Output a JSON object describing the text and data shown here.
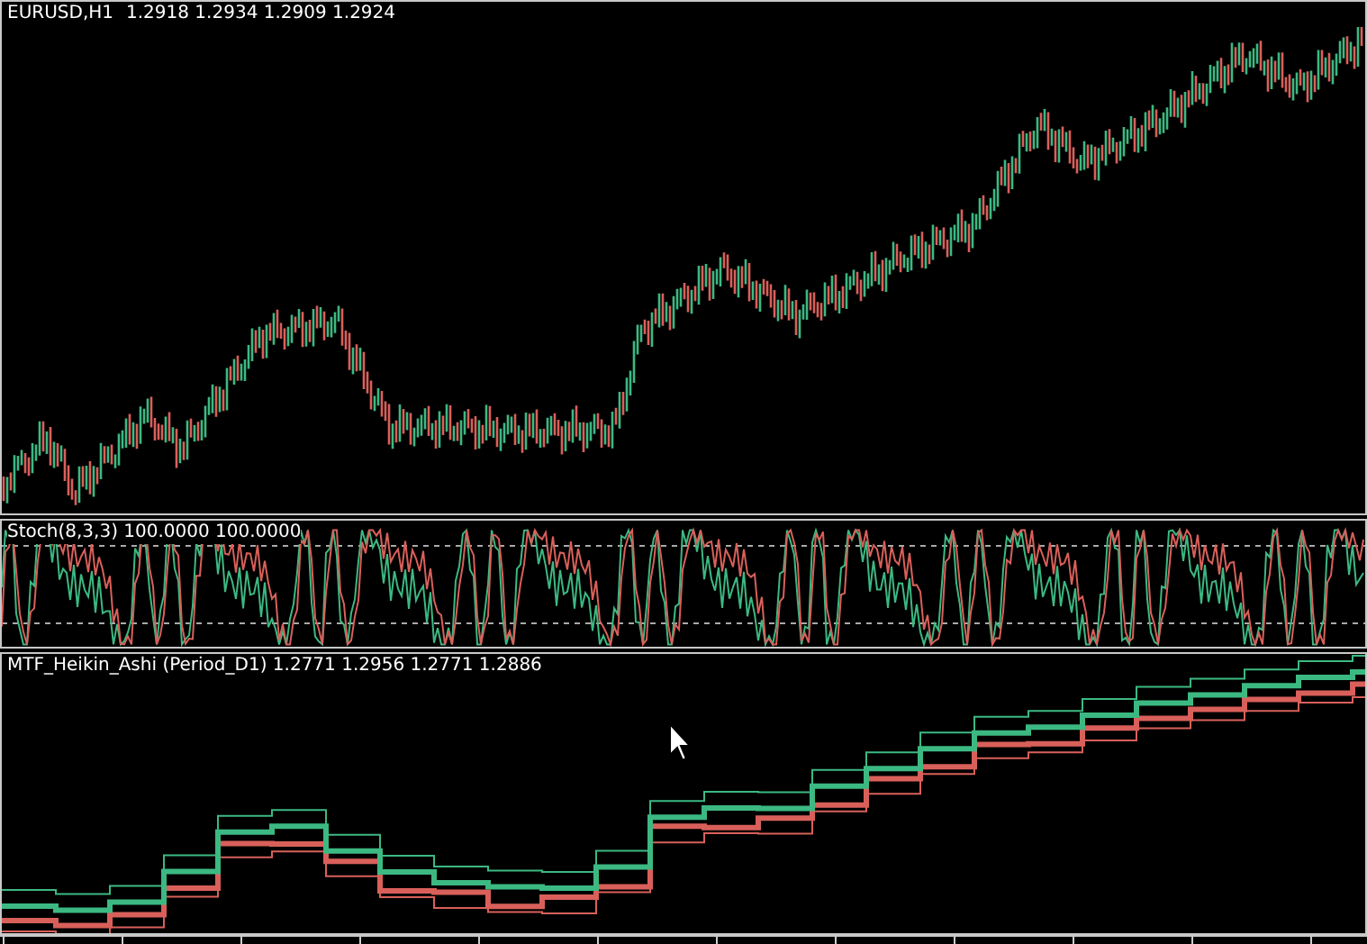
{
  "main_chart": {
    "symbol": "EURUSD,H1",
    "readings": "1.2918 1.2934 1.2909 1.2924"
  },
  "stochastic_pane": {
    "label": "Stoch(8,3,3) 100.0000 100.0000"
  },
  "heikin_ashi_pane": {
    "label": "MTF_Heikin_Ashi (Period_D1) 1.2771 1.2956 1.2771 1.2886"
  }
}
